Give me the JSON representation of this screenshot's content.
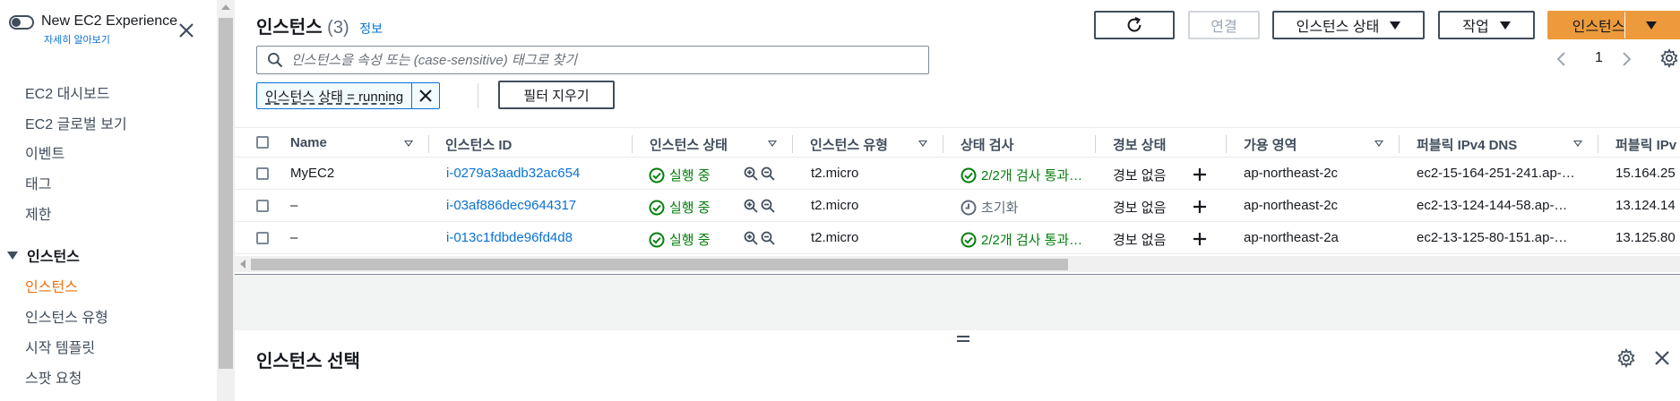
{
  "sidebar": {
    "toggle_title": "New EC2 Experience",
    "toggle_link": "자세히 알아보기",
    "items": [
      {
        "label": "EC2 대시보드"
      },
      {
        "label": "EC2 글로벌 보기"
      },
      {
        "label": "이벤트"
      },
      {
        "label": "태그"
      },
      {
        "label": "제한"
      }
    ],
    "section_instances": "인스턴스",
    "sub_items": [
      {
        "label": "인스턴스",
        "active": true
      },
      {
        "label": "인스턴스 유형"
      },
      {
        "label": "시작 템플릿"
      },
      {
        "label": "스팟 요청"
      }
    ]
  },
  "header": {
    "title": "인스턴스",
    "count": "(3)",
    "info": "정보",
    "buttons": {
      "connect": "연결",
      "instance_state": "인스턴스 상태",
      "actions": "작업",
      "launch": "인스턴스 시작"
    }
  },
  "search": {
    "placeholder": "인스턴스을 속성 또는 (case-sensitive) 태그로 찾기"
  },
  "pagination": {
    "page": "1"
  },
  "filter": {
    "token": "인스턴스 상태 = running",
    "clear": "필터 지우기"
  },
  "table": {
    "columns": [
      "Name",
      "인스턴스 ID",
      "인스턴스 상태",
      "인스턴스 유형",
      "상태 검사",
      "경보 상태",
      "가용 영역",
      "퍼블릭 IPv4 DNS",
      "퍼블릭 IPv"
    ],
    "rows": [
      {
        "name": "MyEC2",
        "id": "i-0279a3aadb32ac654",
        "state": "실행 중",
        "type": "t2.micro",
        "check": "2/2개 검사 통과…",
        "check_ok": true,
        "alarm": "경보 없음",
        "az": "ap-northeast-2c",
        "dns": "ec2-15-164-251-241.ap-…",
        "ip": "15.164.25"
      },
      {
        "name": "–",
        "id": "i-03af886dec9644317",
        "state": "실행 중",
        "type": "t2.micro",
        "check": "초기화",
        "check_ok": false,
        "alarm": "경보 없음",
        "az": "ap-northeast-2c",
        "dns": "ec2-13-124-144-58.ap-…",
        "ip": "13.124.14"
      },
      {
        "name": "–",
        "id": "i-013c1fdbde96fd4d8",
        "state": "실행 중",
        "type": "t2.micro",
        "check": "2/2개 검사 통과…",
        "check_ok": true,
        "alarm": "경보 없음",
        "az": "ap-northeast-2a",
        "dns": "ec2-13-125-80-151.ap-…",
        "ip": "13.125.80"
      }
    ]
  },
  "details": {
    "title": "인스턴스 선택"
  },
  "colors": {
    "accent": "#ec7211",
    "link": "#0972d3",
    "success": "#037f0c",
    "primary_button": "#ec9a3c"
  }
}
